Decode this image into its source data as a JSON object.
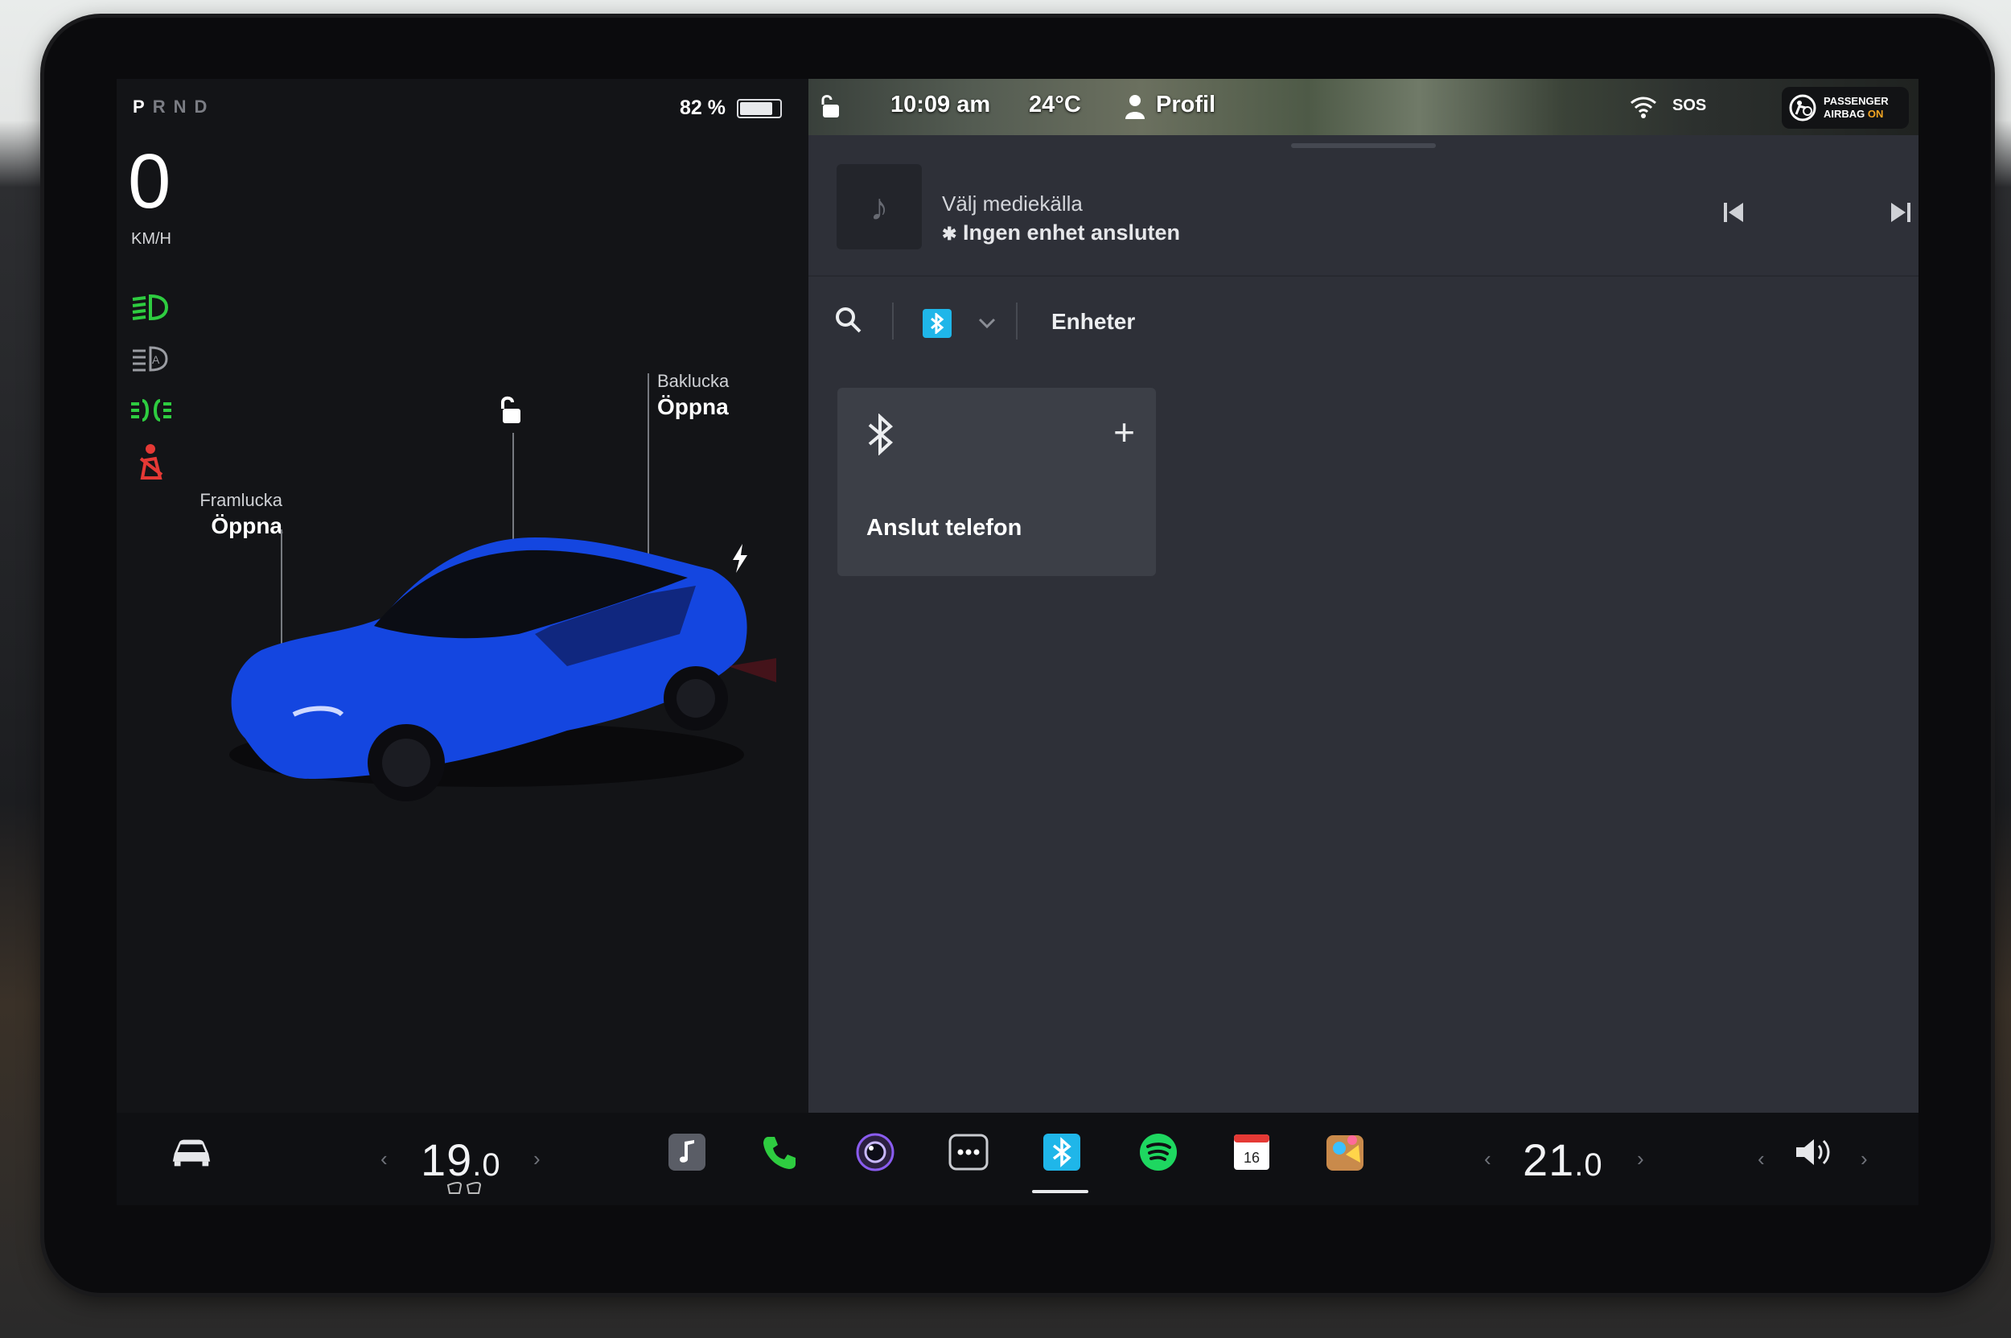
{
  "status": {
    "gears": [
      "P",
      "R",
      "N",
      "D"
    ],
    "active_gear": "P",
    "speed": "0",
    "speed_unit": "KM/H",
    "battery": "82 %",
    "battery_level": 0.82
  },
  "car": {
    "frunk_title": "Framlucka",
    "frunk_action": "Öppna",
    "trunk_title": "Baklucka",
    "trunk_action": "Öppna",
    "color": "#1446e0"
  },
  "topbar": {
    "time": "10:09 am",
    "temperature": "24°C",
    "profile": "Profil",
    "sos": "SOS",
    "airbag_line1": "PASSENGER",
    "airbag_line2": "AIRBAG",
    "airbag_state": "ON"
  },
  "media": {
    "title": "Välj mediekälla",
    "subtitle": "Ingen enhet ansluten",
    "devices_tab": "Enheter",
    "connect_card": "Anslut telefon"
  },
  "dock": {
    "driver_temp": "19",
    "driver_temp_decimal": ".0",
    "passenger_temp": "21",
    "passenger_temp_decimal": ".0",
    "calendar_day": "16",
    "apps": [
      "car-icon",
      "music-icon",
      "phone-icon",
      "camera-icon",
      "more-icon",
      "bluetooth-icon",
      "spotify-icon",
      "calendar-icon",
      "toybox-icon",
      "volume-icon"
    ]
  },
  "colors": {
    "accent_green": "#2ecc40",
    "bluetooth_blue": "#1fb6e9",
    "seatbelt_red": "#e53935",
    "airbag_orange": "#f5a623"
  }
}
